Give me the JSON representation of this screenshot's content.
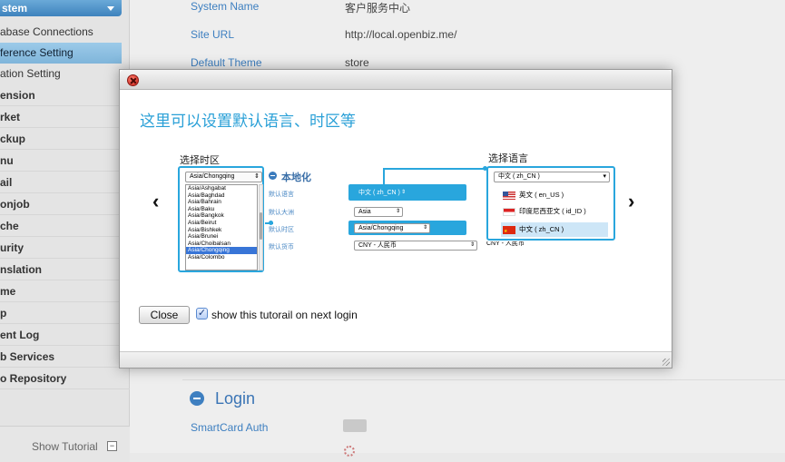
{
  "sidebar": {
    "category": "stem",
    "sub_items": [
      {
        "label": "abase Connections"
      },
      {
        "label": "ference Setting"
      },
      {
        "label": "ation Setting"
      }
    ],
    "main_items": [
      {
        "label": "ension"
      },
      {
        "label": "rket"
      },
      {
        "label": "ckup"
      },
      {
        "label": "nu"
      },
      {
        "label": "ail"
      },
      {
        "label": "onjob"
      },
      {
        "label": "che"
      },
      {
        "label": "urity"
      },
      {
        "label": "nslation"
      },
      {
        "label": "me"
      },
      {
        "label": "p"
      },
      {
        "label": "ent Log"
      },
      {
        "label": "b Services"
      },
      {
        "label": "o Repository"
      }
    ],
    "show_tutorial": "Show Tutorial",
    "show_tutorial_box": "−"
  },
  "settings": [
    {
      "label": "System Name",
      "value": "客户服务中心"
    },
    {
      "label": "Site URL",
      "value": "http://local.openbiz.me/"
    },
    {
      "label": "Default Theme",
      "value": "store"
    }
  ],
  "login_section": {
    "title": "Login",
    "item": "SmartCard Auth"
  },
  "modal": {
    "title": "这里可以设置默认语言、时区等",
    "prev": "‹",
    "next": "›",
    "close_label": "Close",
    "checkbox_checked": true,
    "checkbox_mark": "✓",
    "checkbox_label": "show this tutorail on next login",
    "illustration": {
      "tz_heading": "选择时区",
      "lang_heading": "选择语言",
      "tz_selected": "Asia/Chongqing",
      "tz_options": [
        "Asia/Ashgabat",
        "Asia/Baghdad",
        "Asia/Bahrain",
        "Asia/Baku",
        "Asia/Bangkok",
        "Asia/Beirut",
        "Asia/Bishkek",
        "Asia/Brunei",
        "Asia/Choibalsan",
        "Asia/Chongqing",
        "Asia/Colombo"
      ],
      "local_heading": "本地化",
      "local_rows": [
        {
          "label": "默认语言",
          "value": "中文 ( zh_CN )"
        },
        {
          "label": "默认大洲",
          "value": "Asia"
        },
        {
          "label": "默认时区",
          "value": "Asia/Chongqing"
        },
        {
          "label": "默认货币",
          "value": "CNY - 人民币"
        }
      ],
      "lang_selected": "中文 ( zh_CN )",
      "lang_options": [
        {
          "label": "英文 ( en_US )",
          "flag": "us-flag-icon"
        },
        {
          "label": "印度尼西亚文 ( id_ID )",
          "flag": "id-flag-icon"
        },
        {
          "label": "中文 ( zh_CN )",
          "flag": "cn-flag-icon"
        }
      ],
      "lang_bottom": "CNY - 人民币"
    }
  }
}
